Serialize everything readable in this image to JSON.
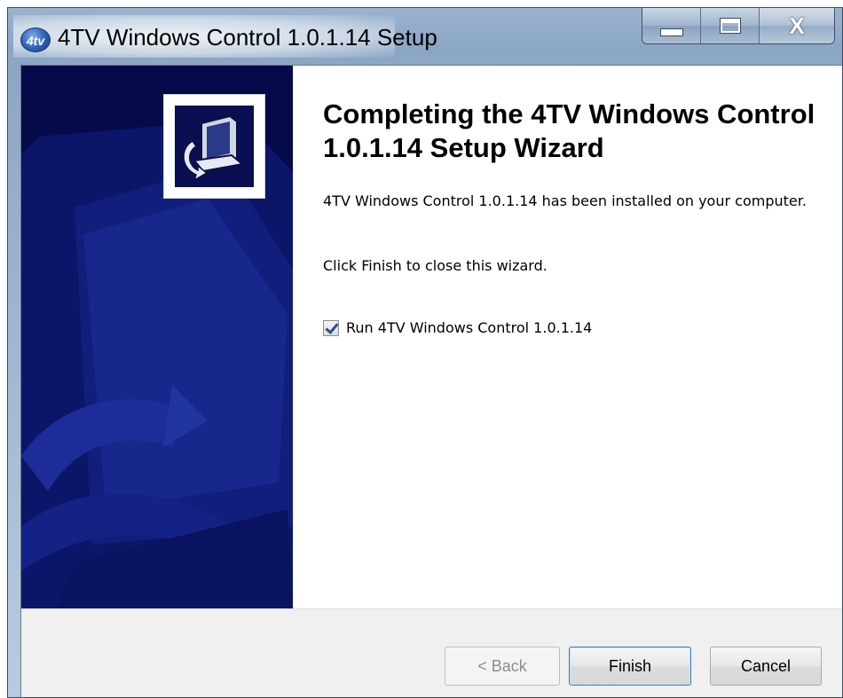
{
  "window": {
    "title": "4TV Windows Control 1.0.1.14 Setup",
    "app_icon_label": "4tv",
    "controls": [
      "minimize-icon",
      "maximize-icon",
      "close-icon"
    ],
    "close_glyph": "X"
  },
  "wizard": {
    "heading": "Completing the 4TV Windows Control 1.0.1.14 Setup Wizard",
    "description": "4TV Windows Control 1.0.1.14 has been installed on your computer.",
    "finish_hint": "Click Finish to close this wizard.",
    "run_checkbox": {
      "label": "Run 4TV Windows Control 1.0.1.14",
      "checked": true
    }
  },
  "footer": {
    "back_label": "< Back",
    "finish_label": "Finish",
    "cancel_label": "Cancel"
  },
  "colors": {
    "side_panel": "#050a4a",
    "accent": "#3c7fb1"
  }
}
